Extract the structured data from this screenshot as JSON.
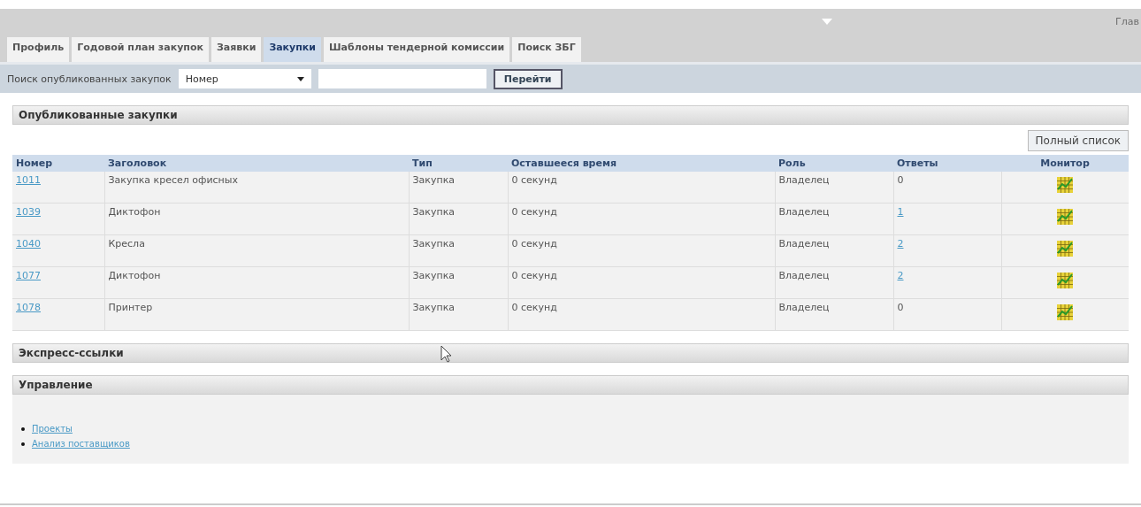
{
  "top_bar": {
    "menu_text": "Глав"
  },
  "tabs": [
    {
      "label": "Профиль",
      "selected": false
    },
    {
      "label": "Годовой план закупок",
      "selected": false
    },
    {
      "label": "Заявки",
      "selected": false
    },
    {
      "label": "Закупки",
      "selected": true
    },
    {
      "label": "Шаблоны тендерной комиссии",
      "selected": false
    },
    {
      "label": "Поиск ЗБГ",
      "selected": false
    }
  ],
  "search": {
    "label": "Поиск опубликованных закупок",
    "select_value": "Номер",
    "button": "Перейти"
  },
  "published": {
    "title": "Опубликованные закупки",
    "full_list_button": "Полный список",
    "columns": [
      "Номер",
      "Заголовок",
      "Тип",
      "Оставшееся время",
      "Роль",
      "Ответы",
      "Монитор"
    ],
    "rows": [
      {
        "number": "1011",
        "title": "Закупка кресел офисных",
        "type": "Закупка",
        "time_left": "0 секунд",
        "role": "Владелец",
        "answers": "0",
        "answers_link": false
      },
      {
        "number": "1039",
        "title": "Диктофон",
        "type": "Закупка",
        "time_left": "0 секунд",
        "role": "Владелец",
        "answers": "1",
        "answers_link": true
      },
      {
        "number": "1040",
        "title": "Кресла",
        "type": "Закупка",
        "time_left": "0 секунд",
        "role": "Владелец",
        "answers": "2",
        "answers_link": true
      },
      {
        "number": "1077",
        "title": "Диктофон",
        "type": "Закупка",
        "time_left": "0 секунд",
        "role": "Владелец",
        "answers": "2",
        "answers_link": true
      },
      {
        "number": "1078",
        "title": "Принтер",
        "type": "Закупка",
        "time_left": "0 секунд",
        "role": "Владелец",
        "answers": "0",
        "answers_link": false
      }
    ]
  },
  "express_links": {
    "title": "Экспресс-ссылки"
  },
  "management": {
    "title": "Управление",
    "links": [
      "Проекты",
      "Анализ поставщиков"
    ]
  }
}
